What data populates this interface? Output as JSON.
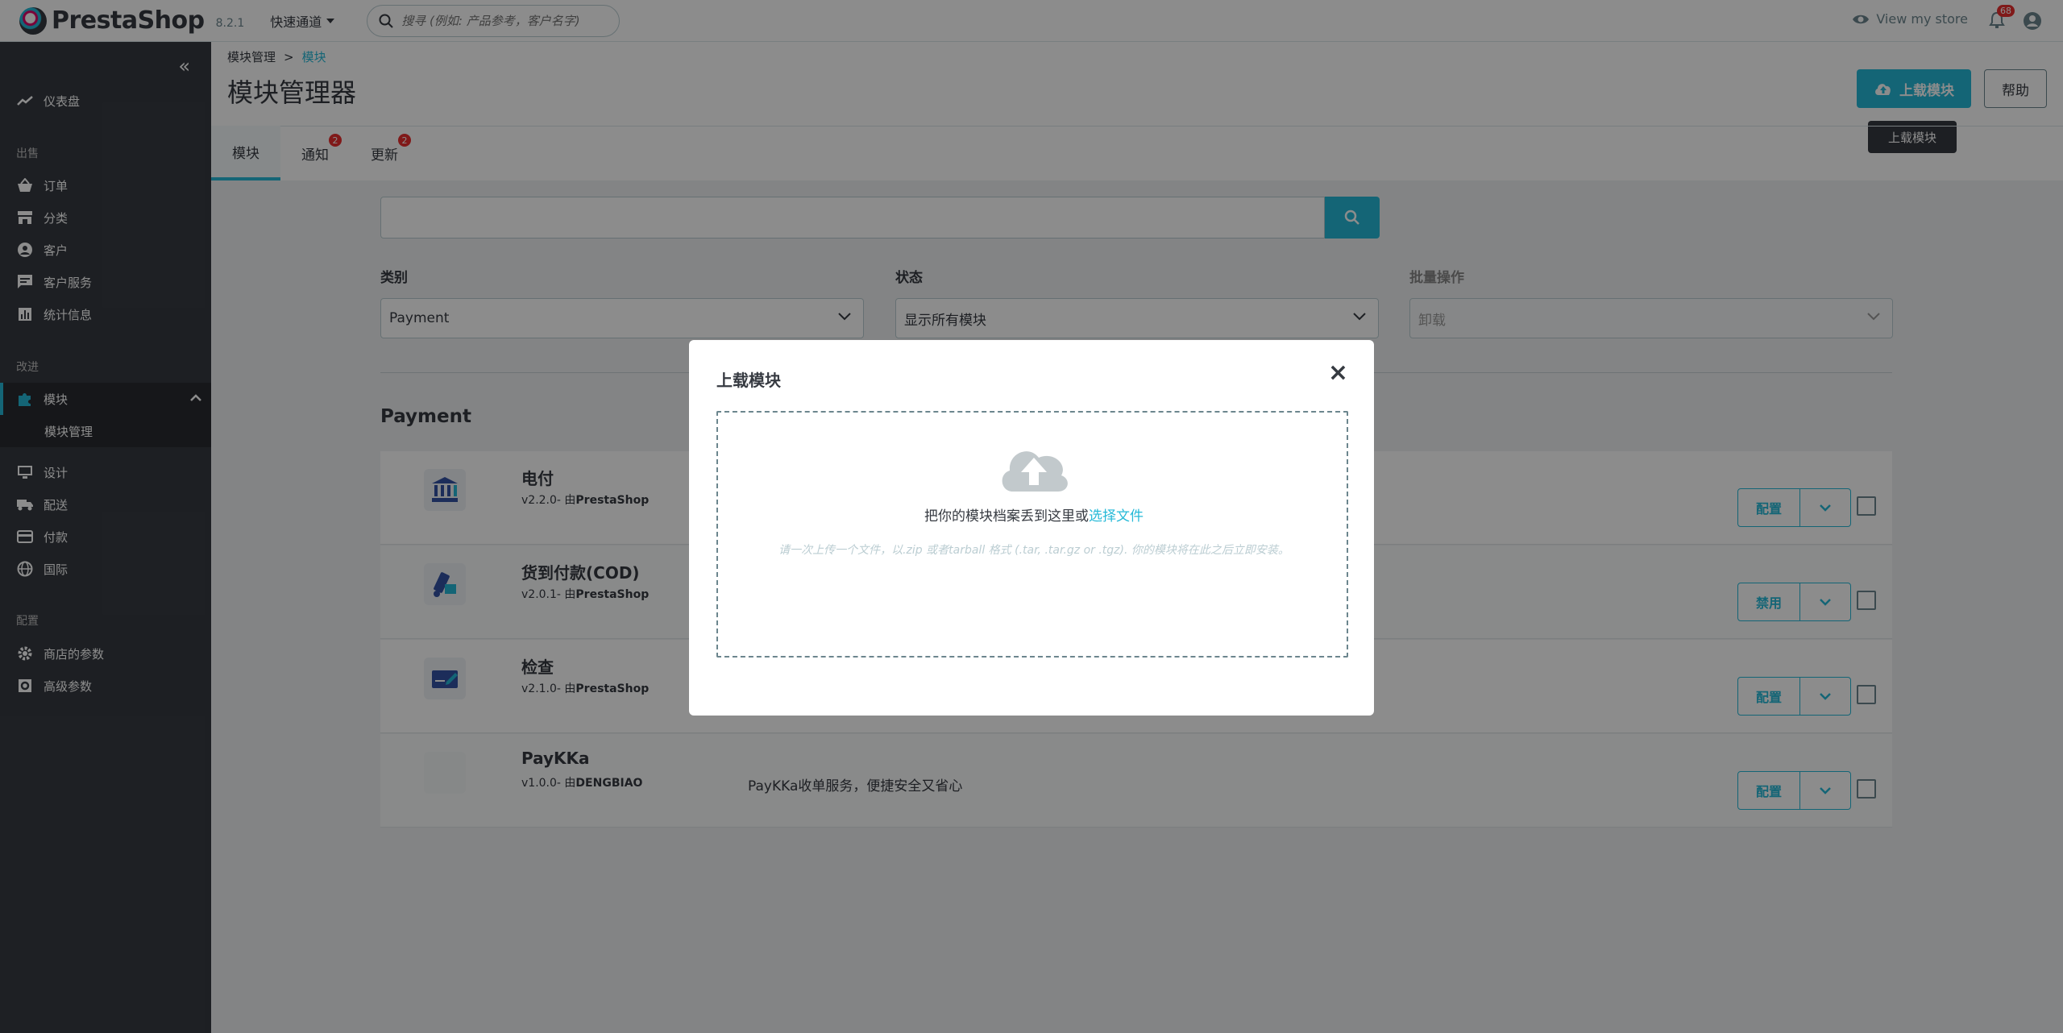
{
  "header": {
    "logo_text": "PrestaShop",
    "version": "8.2.1",
    "quick_access": "快速通道",
    "search_placeholder": "搜寻 (例如: 产品参考，客户名字)",
    "view_store": "View my store",
    "notifications_count": "68"
  },
  "sidebar": {
    "dashboard": "仪表盘",
    "section_sell": "出售",
    "orders": "订单",
    "catalog": "分类",
    "customers": "客户",
    "customer_service": "客户服务",
    "stats": "统计信息",
    "section_improve": "改进",
    "modules": "模块",
    "module_manager": "模块管理",
    "design": "设计",
    "shipping": "配送",
    "payment": "付款",
    "international": "国际",
    "section_config": "配置",
    "shop_params": "商店的参数",
    "advanced_params": "高级参数"
  },
  "page": {
    "breadcrumb_parent": "模块管理",
    "breadcrumb_sep": ">",
    "breadcrumb_current": "模块",
    "title": "模块管理器",
    "upload_button": "上载模块",
    "help_button": "帮助",
    "tooltip": "上载模块",
    "tabs": [
      {
        "label": "模块",
        "badge": ""
      },
      {
        "label": "通知",
        "badge": "2"
      },
      {
        "label": "更新",
        "badge": "2"
      }
    ]
  },
  "filters": {
    "category_label": "类别",
    "category_value": "Payment",
    "status_label": "状态",
    "status_value": "显示所有模块",
    "bulk_label": "批量操作",
    "bulk_value": "卸载"
  },
  "section_title": "Payment",
  "modules": [
    {
      "name": "电付",
      "version": "v2.2.0- 由",
      "author": "PrestaShop",
      "description": "",
      "action": "配置"
    },
    {
      "name": "货到付款(COD)",
      "version": "v2.0.1- 由",
      "author": "PrestaShop",
      "description": "",
      "action": "禁用"
    },
    {
      "name": "检查",
      "version": "v2.1.0- 由",
      "author": "PrestaShop",
      "description": "",
      "action": "配置"
    },
    {
      "name": "PayKKa",
      "version": "v1.0.0- 由",
      "author": "DENGBIAO",
      "description": "PayKKa收单服务，便捷安全又省心",
      "action": "配置"
    }
  ],
  "modal": {
    "title": "上载模块",
    "close": "×",
    "drop_text": "把你的模块档案丢到这里或",
    "choose_file": "选择文件",
    "hint": "请一次上传一个文件，以.zip 或者tarball 格式 (.tar, .tar.gz or .tgz). 你的模块将在此之后立即安装。"
  },
  "colors": {
    "accent": "#25b9d7",
    "sidebar_bg": "#363a41",
    "badge": "#e92f2f"
  }
}
